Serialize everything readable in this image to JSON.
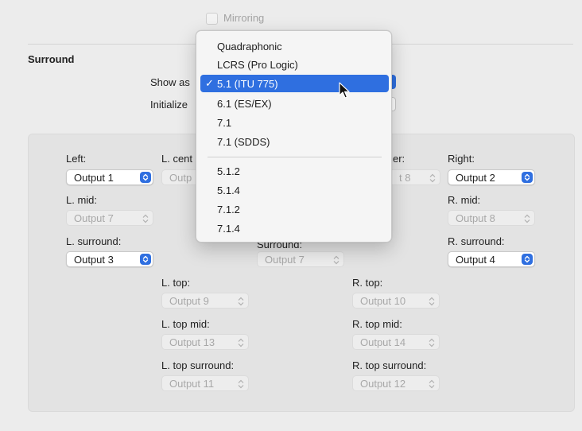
{
  "mirroring": {
    "label": "Mirroring"
  },
  "surround": {
    "title": "Surround",
    "show_as_label": "Show as",
    "initialize_label": "Initialize"
  },
  "menu": {
    "items": [
      "Quadraphonic",
      "LCRS (Pro Logic)",
      "5.1 (ITU 775)",
      "6.1 (ES/EX)",
      "7.1",
      "7.1 (SDDS)",
      "5.1.2",
      "5.1.4",
      "7.1.2",
      "7.1.4"
    ],
    "selected": "5.1 (ITU 775)",
    "checkmark": "✓"
  },
  "speakers": {
    "left": {
      "label": "Left:",
      "value": "Output 1"
    },
    "l_center": {
      "label": "L. cent",
      "value": "Outp"
    },
    "r_center": {
      "label": "er:",
      "value": "t 8"
    },
    "right": {
      "label": "Right:",
      "value": "Output 2"
    },
    "l_mid": {
      "label": "L. mid:",
      "value": "Output 7"
    },
    "r_mid": {
      "label": "R. mid:",
      "value": "Output 8"
    },
    "l_surround": {
      "label": "L. surround:",
      "value": "Output 3"
    },
    "c_surround": {
      "label": "Surround:",
      "value": "Output 7"
    },
    "r_surround": {
      "label": "R. surround:",
      "value": "Output 4"
    },
    "l_top": {
      "label": "L. top:",
      "value": "Output 9"
    },
    "r_top": {
      "label": "R. top:",
      "value": "Output 10"
    },
    "l_top_mid": {
      "label": "L. top mid:",
      "value": "Output 13"
    },
    "r_top_mid": {
      "label": "R. top mid:",
      "value": "Output 14"
    },
    "l_top_surround": {
      "label": "L. top surround:",
      "value": "Output 11"
    },
    "r_top_surround": {
      "label": "R. top surround:",
      "value": "Output 12"
    }
  }
}
